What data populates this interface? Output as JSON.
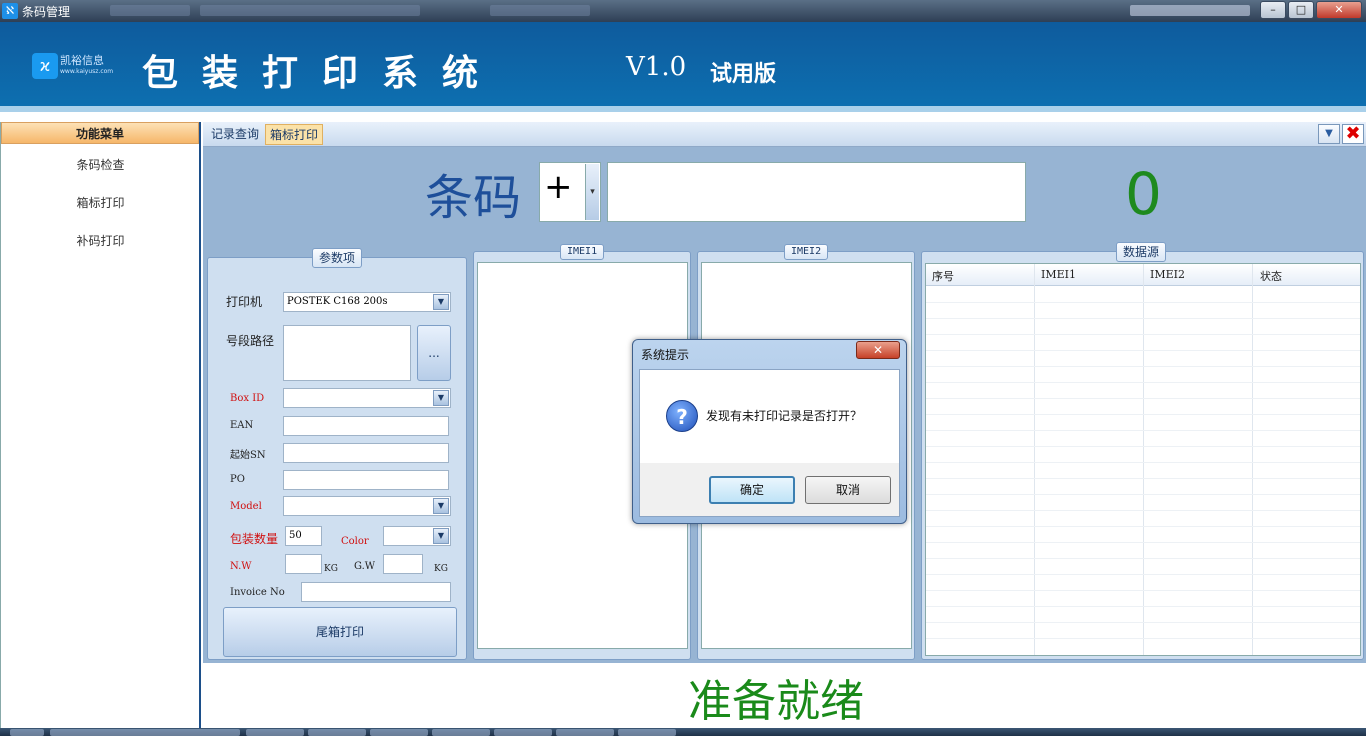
{
  "window": {
    "title": "条码管理",
    "app_icon": "barcode-app-icon",
    "buttons": {
      "minimize": "–",
      "maximize": "□",
      "close": "✕"
    }
  },
  "header": {
    "logo_icon": "kaiyu-logo-icon",
    "logo_text": "凯裕信息",
    "logo_url": "www.kaiyusz.com",
    "title": "包装打印系统",
    "version": "V1.0",
    "edition": "试用版",
    "background_color": "#0d63a6"
  },
  "sidebar": {
    "header": "功能菜单",
    "items": [
      {
        "label": "条码检查"
      },
      {
        "label": "箱标打印"
      },
      {
        "label": "补码打印"
      }
    ]
  },
  "tabs": [
    {
      "label": "记录查询",
      "active": false
    },
    {
      "label": "箱标打印",
      "active": true
    }
  ],
  "scan": {
    "label": "条码",
    "prefix": "+",
    "barcode_value": "",
    "count": "0"
  },
  "params": {
    "title": "参数项",
    "printer_label": "打印机",
    "printer_value": "POSTEK C168 200s",
    "segment_path_label": "号段路径",
    "browse_button": "...",
    "box_id_label": "Box ID",
    "ean_label": "EAN",
    "start_sn_label": "起始SN",
    "po_label": "PO",
    "model_label": "Model",
    "pack_qty_label": "包装数量",
    "pack_qty_value": "50",
    "color_label": "Color",
    "nw_label": "N.W",
    "gw_label": "G.W",
    "unit_kg": "KG",
    "invoice_label": "Invoice No",
    "tail_print_button": "尾箱打印"
  },
  "imei1": {
    "title": "IMEI1"
  },
  "imei2": {
    "title": "IMEI2"
  },
  "datasource": {
    "title": "数据源",
    "columns": [
      "序号",
      "IMEI1",
      "IMEI2",
      "状态"
    ]
  },
  "status": {
    "text": "准备就绪",
    "color": "#1a8a1a"
  },
  "dialog": {
    "title": "系统提示",
    "close": "✕",
    "icon": "question-icon",
    "message": "发现有未打印记录是否打开？",
    "ok_button": "确定",
    "cancel_button": "取消"
  }
}
